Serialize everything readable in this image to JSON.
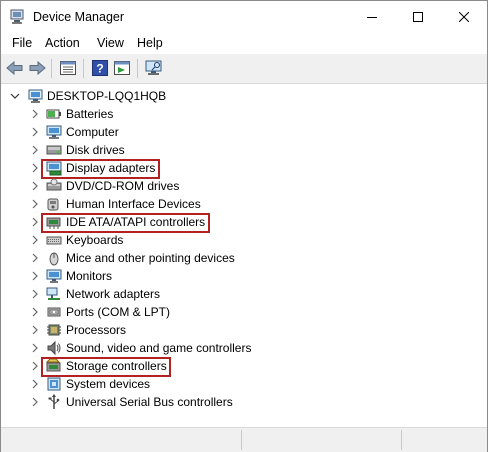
{
  "window": {
    "title": "Device Manager"
  },
  "menu": {
    "file": "File",
    "action": "Action",
    "view": "View",
    "help": "Help"
  },
  "toolbar_icons": [
    "back-arrow-icon",
    "forward-arrow-icon",
    "properties-grid-icon",
    "help-icon",
    "update-driver-icon",
    "scan-hardware-monitor-icon"
  ],
  "tree": {
    "root_label": "DESKTOP-LQQ1HQB",
    "categories": [
      {
        "label": "Batteries",
        "icon": "battery-icon",
        "highlighted": false
      },
      {
        "label": "Computer",
        "icon": "computer-icon",
        "highlighted": false
      },
      {
        "label": "Disk drives",
        "icon": "disk-drive-icon",
        "highlighted": false
      },
      {
        "label": "Display adapters",
        "icon": "display-adapter-icon",
        "highlighted": true
      },
      {
        "label": "DVD/CD-ROM drives",
        "icon": "dvd-drive-icon",
        "highlighted": false
      },
      {
        "label": "Human Interface Devices",
        "icon": "hid-icon",
        "highlighted": false
      },
      {
        "label": "IDE ATA/ATAPI controllers",
        "icon": "ide-controller-icon",
        "highlighted": true
      },
      {
        "label": "Keyboards",
        "icon": "keyboard-icon",
        "highlighted": false
      },
      {
        "label": "Mice and other pointing devices",
        "icon": "mouse-icon",
        "highlighted": false
      },
      {
        "label": "Monitors",
        "icon": "monitor-icon",
        "highlighted": false
      },
      {
        "label": "Network adapters",
        "icon": "network-adapter-icon",
        "highlighted": false
      },
      {
        "label": "Ports (COM & LPT)",
        "icon": "port-icon",
        "highlighted": false
      },
      {
        "label": "Processors",
        "icon": "processor-icon",
        "highlighted": false
      },
      {
        "label": "Sound, video and game controllers",
        "icon": "sound-icon",
        "highlighted": false
      },
      {
        "label": "Storage controllers",
        "icon": "storage-controller-icon",
        "highlighted": true
      },
      {
        "label": "System devices",
        "icon": "system-device-icon",
        "highlighted": false
      },
      {
        "label": "Universal Serial Bus controllers",
        "icon": "usb-icon",
        "highlighted": false
      }
    ]
  },
  "colors": {
    "highlight_border": "#b22222",
    "toolbar_bg": "#f0f0f0"
  }
}
